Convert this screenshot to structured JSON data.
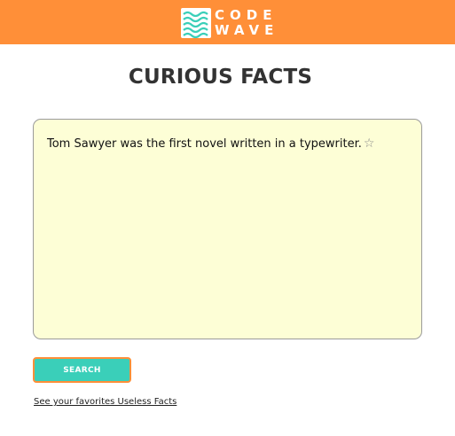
{
  "header": {
    "logo_line1": "CODE",
    "logo_line2": "WAVE",
    "background_color": "#ff8f38",
    "logo_mark_color": "#3acfb9",
    "logo_icon": "waves-icon"
  },
  "main": {
    "title": "CURIOUS FACTS",
    "fact_text": "Tom Sawyer was the first novel written in a typewriter.",
    "favorite_icon": "star-outline-icon",
    "favorite_glyph": "☆",
    "fact_box_color": "#fdfed6"
  },
  "actions": {
    "search_label": "SEARCH",
    "search_color": "#3acfb9",
    "favorites_link": "See your favorites Useless Facts"
  }
}
